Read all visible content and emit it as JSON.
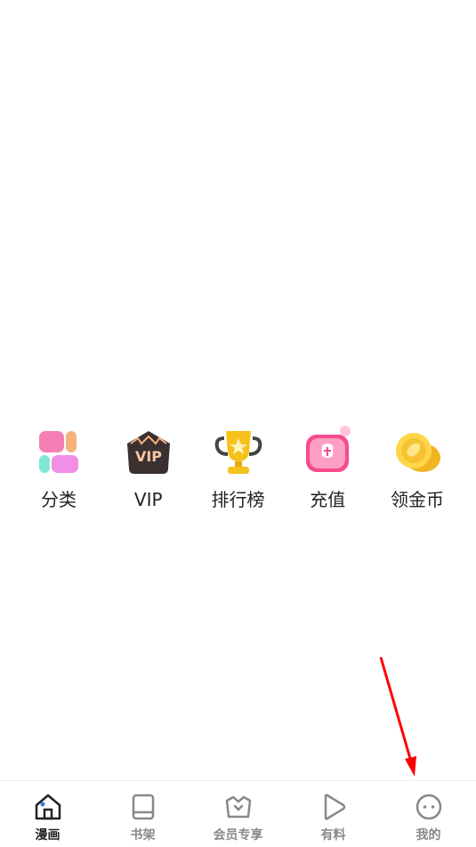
{
  "quick_menu": {
    "items": [
      {
        "label": "分类",
        "icon": "category-icon"
      },
      {
        "label": "VIP",
        "icon": "vip-crown-icon"
      },
      {
        "label": "排行榜",
        "icon": "trophy-icon"
      },
      {
        "label": "充值",
        "icon": "recharge-icon"
      },
      {
        "label": "领金币",
        "icon": "gold-coin-icon"
      }
    ]
  },
  "tabbar": {
    "items": [
      {
        "label": "漫画",
        "icon": "home-icon",
        "active": true
      },
      {
        "label": "书架",
        "icon": "book-icon",
        "active": false
      },
      {
        "label": "会员专享",
        "icon": "vip-basket-icon",
        "active": false
      },
      {
        "label": "有料",
        "icon": "play-icon",
        "active": false
      },
      {
        "label": "我的",
        "icon": "profile-face-icon",
        "active": false
      }
    ]
  },
  "colors": {
    "accent": "#3a7bd5",
    "annotation_arrow": "#ff0000",
    "active_text": "#222222",
    "inactive_text": "#888888"
  }
}
